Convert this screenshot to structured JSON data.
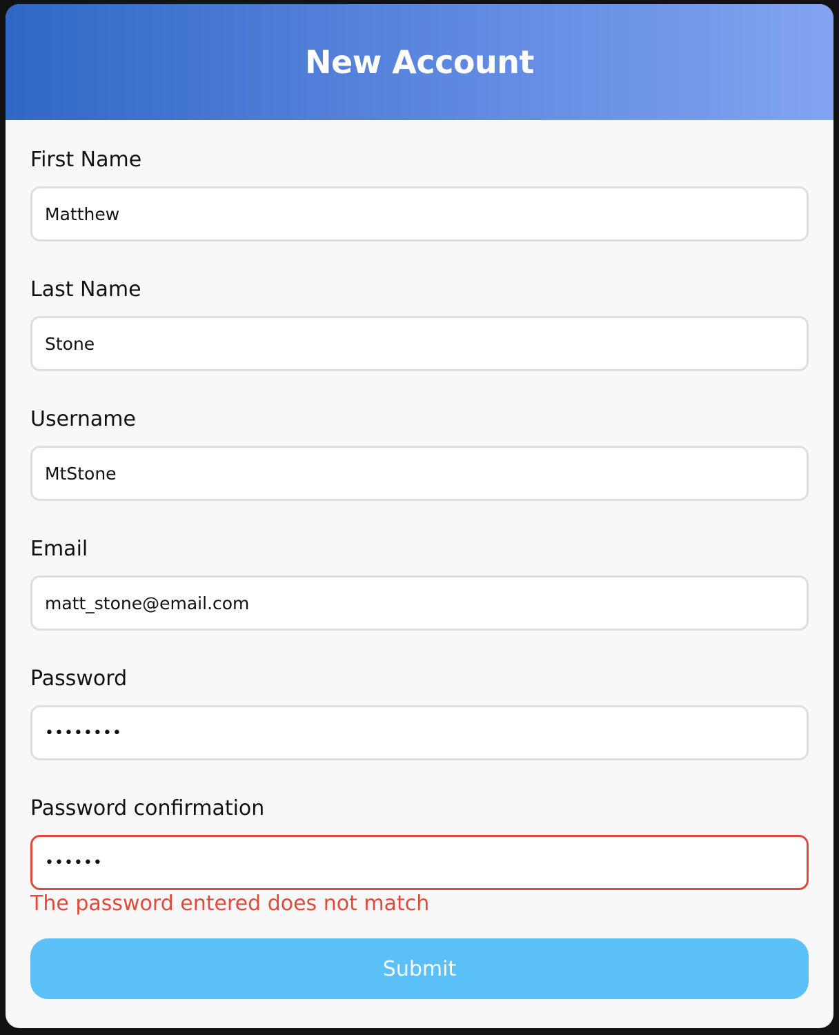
{
  "header": {
    "title": "New Account"
  },
  "fields": [
    {
      "label": "First Name",
      "value": "Matthew",
      "type": "text"
    },
    {
      "label": "Last Name",
      "value": "Stone",
      "type": "text"
    },
    {
      "label": "Username",
      "value": "MtStone",
      "type": "text"
    },
    {
      "label": "Email",
      "value": "matt_stone@email.com",
      "type": "email"
    },
    {
      "label": "Password",
      "value": "••••••••",
      "type": "password"
    },
    {
      "label": "Password confirmation",
      "value": "••••••",
      "type": "password",
      "error": true
    }
  ],
  "error_message": "The password entered does not match",
  "submit_label": "Submit",
  "colors": {
    "header_gradient_start": "#3068c6",
    "header_gradient_end": "#82a3f1",
    "error": "#df4b3a",
    "submit_bg": "#5bc0f8",
    "input_border": "#dedede"
  }
}
